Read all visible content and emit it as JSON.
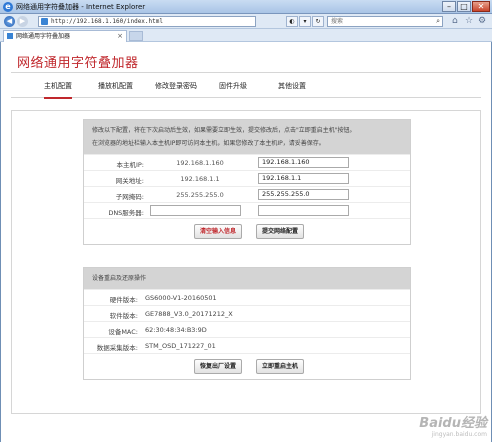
{
  "window": {
    "title": "网络通用字符叠加器 - Internet Explorer",
    "address": "http://192.168.1.160/index.html",
    "search_placeholder": "搜索",
    "tab_label": "网络通用字符叠加器"
  },
  "brand": "网络通用字符叠加器",
  "nav": [
    "主机配置",
    "播放机配置",
    "修改登录密码",
    "固件升级",
    "其他设置"
  ],
  "network": {
    "notice": [
      "修改以下配置，将在下次启动后生效，如果需要立即生效，提交修改后，点击\"立即重启主机\"按钮。",
      "在浏览器的地址栏输入本主机IP即可访问本主机，如果您修改了本主机IP，请妥善保存。"
    ],
    "rows": [
      {
        "label": "本主机IP:",
        "current": "192.168.1.160",
        "input": "192.168.1.160"
      },
      {
        "label": "网关地址:",
        "current": "192.168.1.1",
        "input": "192.168.1.1"
      },
      {
        "label": "子网掩码:",
        "current": "255.255.255.0",
        "input": "255.255.255.0"
      },
      {
        "label": "DNS服务器:",
        "current": "",
        "input": ""
      }
    ],
    "clear_button": "清空输入信息",
    "submit_button": "提交网络配置"
  },
  "device": {
    "title": "设备重启及还原操作",
    "rows": [
      {
        "label": "硬件版本:",
        "value": "GS6000-V1-20160501"
      },
      {
        "label": "软件版本:",
        "value": "GE7888_V3.0_20171212_X"
      },
      {
        "label": "设备MAC:",
        "value": "62:30:48:34:B3:9D"
      },
      {
        "label": "数据采集版本:",
        "value": "STM_OSD_171227_01"
      }
    ],
    "restore_button": "恢复出厂设置",
    "reboot_button": "立即重启主机"
  },
  "watermark": {
    "main": "Baidu经验",
    "sub": "jingyan.baidu.com"
  },
  "colors": {
    "accent": "#c0282d",
    "panel_header": "#d4d4d4"
  },
  "icons": [
    "ie-logo-icon",
    "back-icon",
    "forward-icon",
    "page-icon",
    "refresh-icon",
    "search-icon",
    "home-icon",
    "star-icon",
    "gear-icon"
  ]
}
